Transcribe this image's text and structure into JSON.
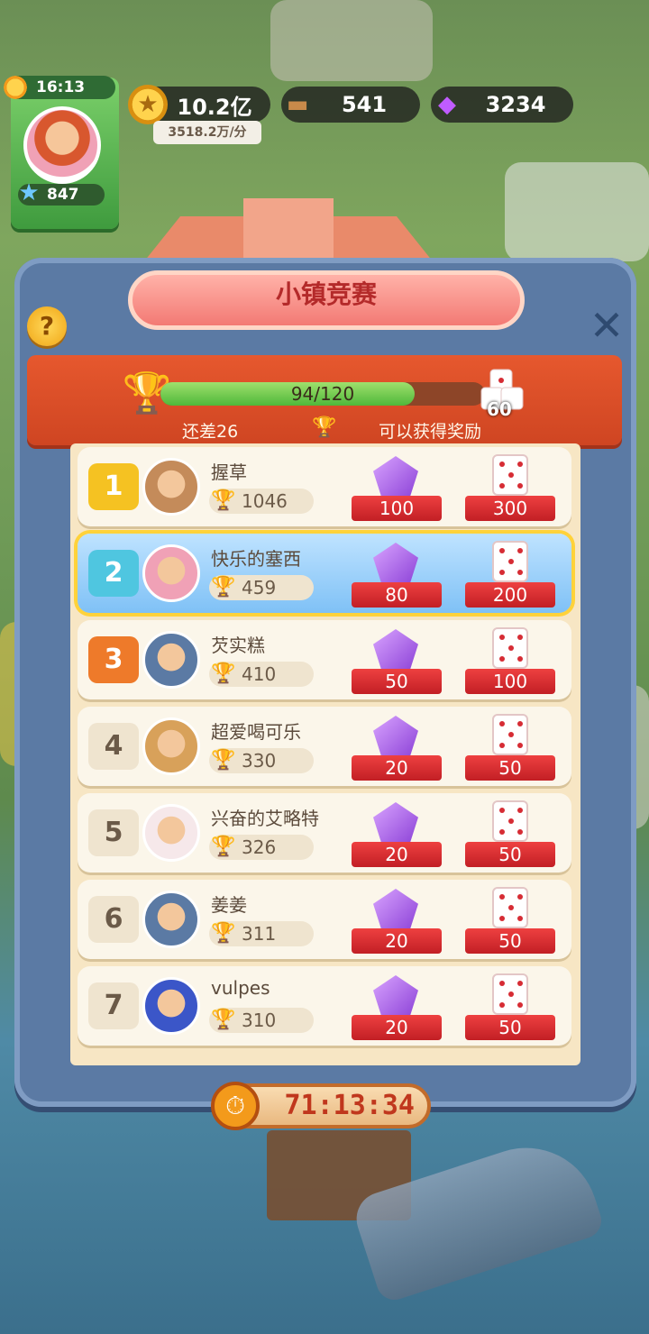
{
  "hud": {
    "time": "16:13",
    "level": "847",
    "coins": "10.2亿",
    "coin_rate": "3518.2万/分",
    "wood": "541",
    "gems": "3234"
  },
  "panel": {
    "title": "小镇竞赛",
    "progress_text": "94/120",
    "progress_fraction": 0.783,
    "goal_dice": "60",
    "remaining": "还差26",
    "reward_note": "可以获得奖励",
    "timer": "71:13:34"
  },
  "players": [
    {
      "rank": "1",
      "name": "握草",
      "score": "1046",
      "gems": "100",
      "dice": "300",
      "badge_color": "#f5c222"
    },
    {
      "rank": "2",
      "name": "快乐的塞西",
      "score": "459",
      "gems": "80",
      "dice": "200",
      "badge_color": "#4fc6e0"
    },
    {
      "rank": "3",
      "name": "芡实糕",
      "score": "410",
      "gems": "50",
      "dice": "100",
      "badge_color": "#ee7a2a"
    },
    {
      "rank": "4",
      "name": "超爱喝可乐",
      "score": "330",
      "gems": "20",
      "dice": "50",
      "badge_color": "#efe4cf"
    },
    {
      "rank": "5",
      "name": "兴奋的艾略特",
      "score": "326",
      "gems": "20",
      "dice": "50",
      "badge_color": "#efe4cf"
    },
    {
      "rank": "6",
      "name": "姜姜",
      "score": "311",
      "gems": "20",
      "dice": "50",
      "badge_color": "#efe4cf"
    },
    {
      "rank": "7",
      "name": "vulpes",
      "score": "310",
      "gems": "20",
      "dice": "50",
      "badge_color": "#efe4cf"
    }
  ]
}
